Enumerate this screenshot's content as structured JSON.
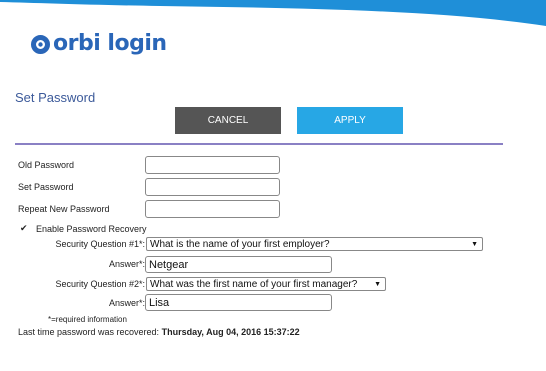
{
  "brand": {
    "name": "orbi login",
    "logo_icon": "orbi-logo-icon",
    "accent_color": "#2a66b8",
    "wave_color": "#1f8fd8"
  },
  "page": {
    "title": "Set Password"
  },
  "buttons": {
    "cancel_label": "CANCEL",
    "apply_label": "APPLY",
    "cancel_color": "#555555",
    "apply_color": "#27a7e5"
  },
  "form": {
    "old_password_label": "Old Password",
    "old_password_value": "",
    "set_password_label": "Set Password",
    "set_password_value": "",
    "repeat_password_label": "Repeat New Password",
    "repeat_password_value": "",
    "recovery_label": "Enable Password Recovery",
    "recovery_checked": true,
    "question1_label": "Security Question #1*:",
    "question1_value": "What is the name of your first employer?",
    "answer1_label": "Answer*:",
    "answer1_value": "Netgear",
    "question2_label": "Security Question #2*:",
    "question2_value": "What was the first name of your first manager?",
    "answer2_label": "Answer*:",
    "answer2_value": "Lisa",
    "required_note": "*=required information",
    "last_recovered_label": "Last time password was recovered:",
    "last_recovered_value": "Thursday, Aug 04, 2016 15:37:22"
  }
}
